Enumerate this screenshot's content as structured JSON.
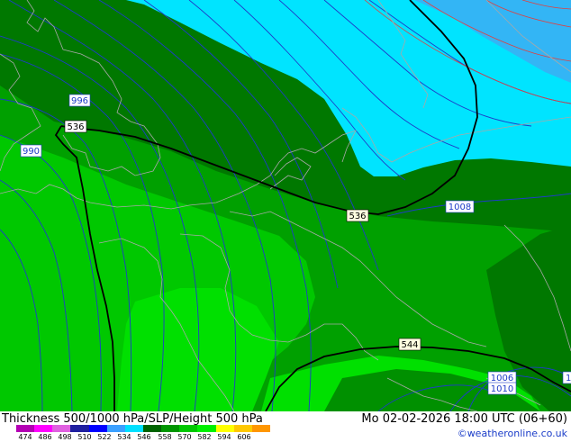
{
  "map": {
    "contour_labels": {
      "slp": [
        "996",
        "990",
        "1008",
        "1006",
        "1010",
        "1"
      ],
      "thickness": [
        "536",
        "536",
        "544"
      ]
    }
  },
  "footer": {
    "title": "Thickness 500/1000 hPa/SLP/Height 500 hPa",
    "datetime": "Mo 02-02-2026 18:00 UTC (06+60)",
    "credit": "©weatheronline.co.uk",
    "legend_ticks": [
      "474",
      "486",
      "498",
      "510",
      "522",
      "534",
      "546",
      "558",
      "570",
      "582",
      "594",
      "606"
    ],
    "legend_colors": [
      "#b400b4",
      "#ff00ff",
      "#e060e0",
      "#2020a0",
      "#0000ff",
      "#3ca0ff",
      "#00e0ff",
      "#006400",
      "#009600",
      "#00c800",
      "#00f000",
      "#ffff00",
      "#ffc800",
      "#ff9600"
    ]
  },
  "colors": {
    "cyan": "#00e4ff",
    "light_blue": "#33b5f5",
    "dark_green": "#007800",
    "green": "#00a000",
    "bright_green": "#00c800",
    "lime": "#00e000",
    "isobar": "#1e3cc8",
    "height_line": "#000000",
    "coast": "#a8a8a8",
    "red_line": "#e04040"
  }
}
